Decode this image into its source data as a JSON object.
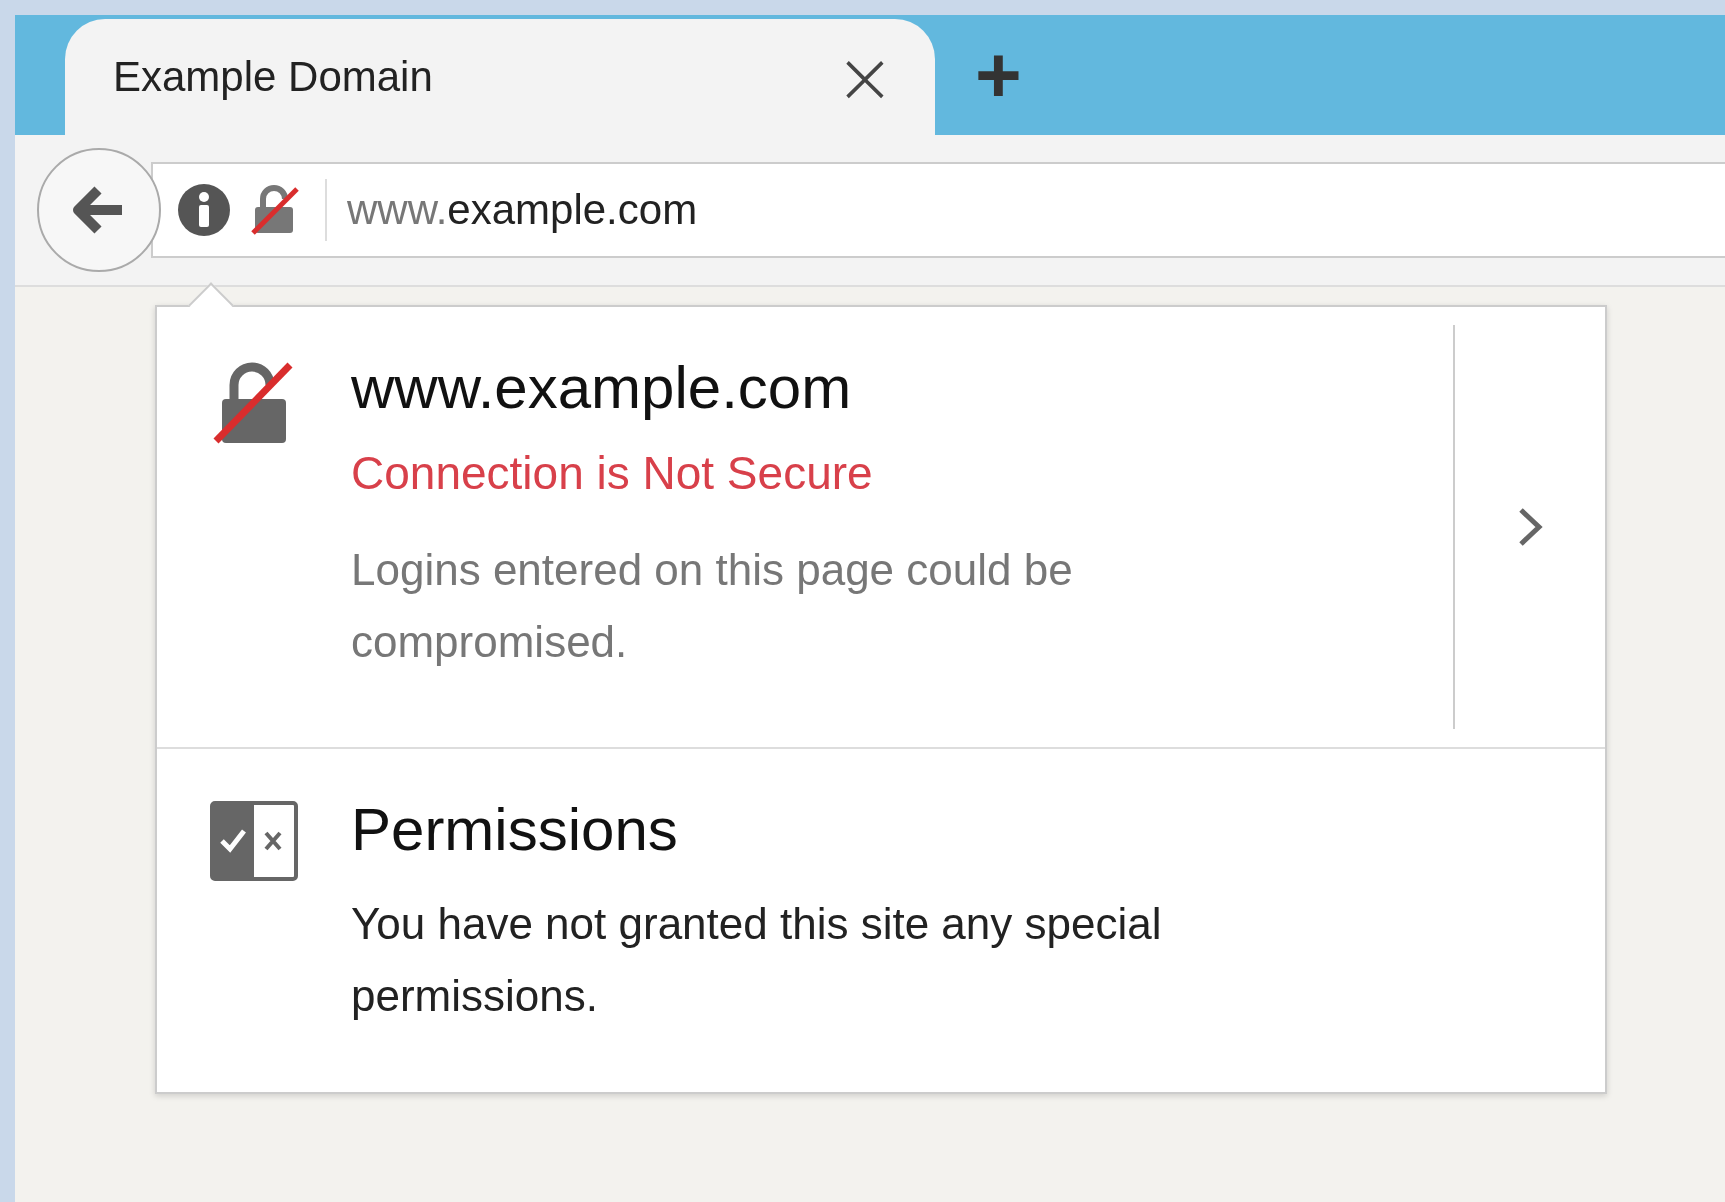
{
  "tab": {
    "title": "Example Domain",
    "close": "×",
    "new_tab": "+"
  },
  "address_bar": {
    "url_prefix": "www.",
    "url_host": "example.com"
  },
  "site_panel": {
    "host": "www.example.com",
    "status": "Connection is Not Secure",
    "secure": false,
    "description": "Logins entered on this page could be compromised."
  },
  "permissions": {
    "title": "Permissions",
    "description": "You have not granted this site any special permissions."
  }
}
